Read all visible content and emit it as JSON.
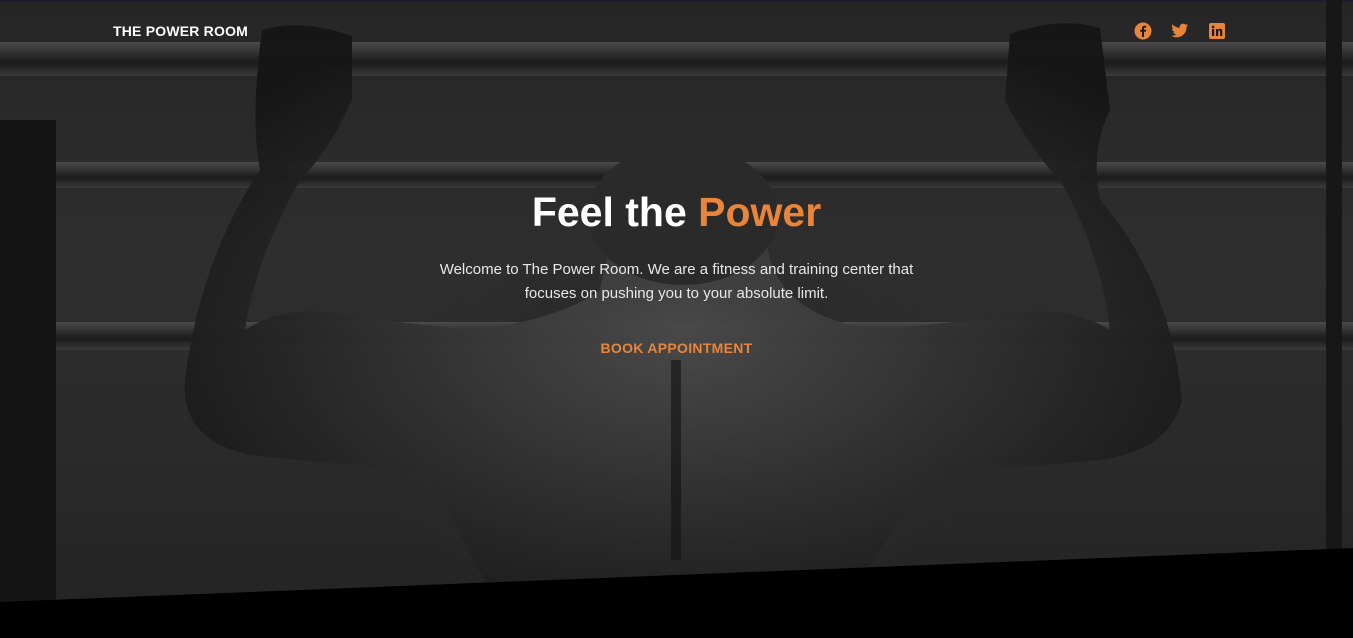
{
  "nav": {
    "brand": "THE POWER ROOM",
    "socials": [
      {
        "name": "facebook-icon",
        "color": "#e8853a"
      },
      {
        "name": "twitter-icon",
        "color": "#e8853a"
      },
      {
        "name": "linkedin-icon",
        "color": "#e8853a"
      }
    ]
  },
  "hero": {
    "headline_prefix": "Feel the ",
    "headline_accent": "Power",
    "tagline": "Welcome to The Power Room. We are a fitness and training center that focuses on pushing you to your absolute limit.",
    "cta_label": "BOOK APPOINTMENT"
  },
  "colors": {
    "accent": "#e8853a",
    "text": "#ffffff",
    "background": "#000000"
  }
}
